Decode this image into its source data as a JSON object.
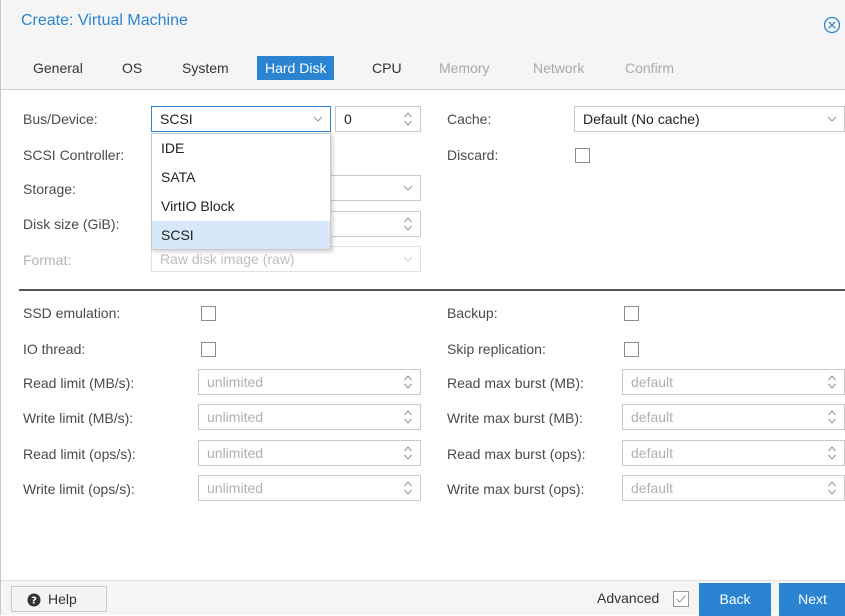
{
  "window": {
    "title": "Create: Virtual Machine"
  },
  "tabs": [
    {
      "label": "General",
      "state": "normal"
    },
    {
      "label": "OS",
      "state": "normal"
    },
    {
      "label": "System",
      "state": "normal"
    },
    {
      "label": "Hard Disk",
      "state": "active"
    },
    {
      "label": "CPU",
      "state": "normal"
    },
    {
      "label": "Memory",
      "state": "disabled"
    },
    {
      "label": "Network",
      "state": "disabled"
    },
    {
      "label": "Confirm",
      "state": "disabled"
    }
  ],
  "form": {
    "bus_device_label": "Bus/Device:",
    "bus_value": "SCSI",
    "device_value": "0",
    "scsi_controller_label": "SCSI Controller:",
    "storage_label": "Storage:",
    "disk_size_label": "Disk size (GiB):",
    "format_label": "Format:",
    "format_value": "Raw disk image (raw)",
    "cache_label": "Cache:",
    "cache_value": "Default (No cache)",
    "discard_label": "Discard:"
  },
  "dropdown": {
    "options": [
      "IDE",
      "SATA",
      "VirtIO Block",
      "SCSI"
    ],
    "selected": "SCSI"
  },
  "advanced": {
    "ssd_emulation_label": "SSD emulation:",
    "io_thread_label": "IO thread:",
    "read_limit_mbs_label": "Read limit (MB/s):",
    "write_limit_mbs_label": "Write limit (MB/s):",
    "read_limit_ops_label": "Read limit (ops/s):",
    "write_limit_ops_label": "Write limit (ops/s):",
    "limit_placeholder": "unlimited",
    "backup_label": "Backup:",
    "skip_replication_label": "Skip replication:",
    "read_burst_mb_label": "Read max burst (MB):",
    "write_burst_mb_label": "Write max burst (MB):",
    "read_burst_ops_label": "Read max burst (ops):",
    "write_burst_ops_label": "Write max burst (ops):",
    "burst_placeholder": "default"
  },
  "footer": {
    "help_label": "Help",
    "advanced_label": "Advanced",
    "back_label": "Back",
    "next_label": "Next"
  },
  "colors": {
    "accent": "#2a84d1",
    "title": "#2a84d1",
    "selected_option": "#d7e8f8"
  },
  "icons": {
    "close": "close-circle-icon",
    "help": "question-circle-icon",
    "dropdown": "chevron-down-icon",
    "spinner": "spinner-arrows-icon"
  }
}
